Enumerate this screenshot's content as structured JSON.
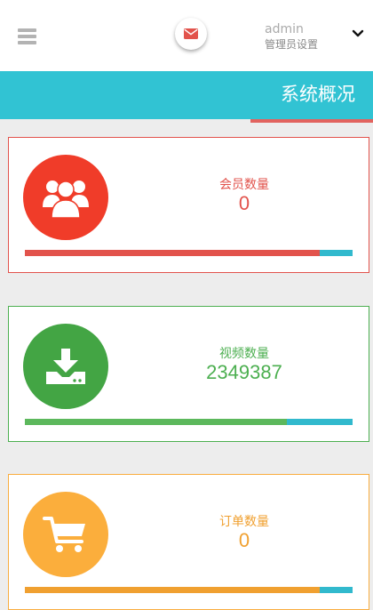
{
  "header": {
    "menu_icon": "hamburger-icon",
    "mail_icon": "envelope-icon",
    "user_name": "admin",
    "user_subtitle": "管理员设置",
    "caret_icon": "chevron-down-icon"
  },
  "page": {
    "title": "系统概况"
  },
  "colors": {
    "accent": "#31c3d3",
    "red": "#e2534c",
    "green": "#4caf50",
    "orange": "#f9ad3f"
  },
  "stats": [
    {
      "label": "会员数量",
      "value": "0",
      "icon": "users-icon",
      "progress": 0.9
    },
    {
      "label": "视频数量",
      "value": "2349387",
      "icon": "download-icon",
      "progress": 0.8
    },
    {
      "label": "订单数量",
      "value": "0",
      "icon": "shopping-cart-icon",
      "progress": 0.9
    }
  ]
}
